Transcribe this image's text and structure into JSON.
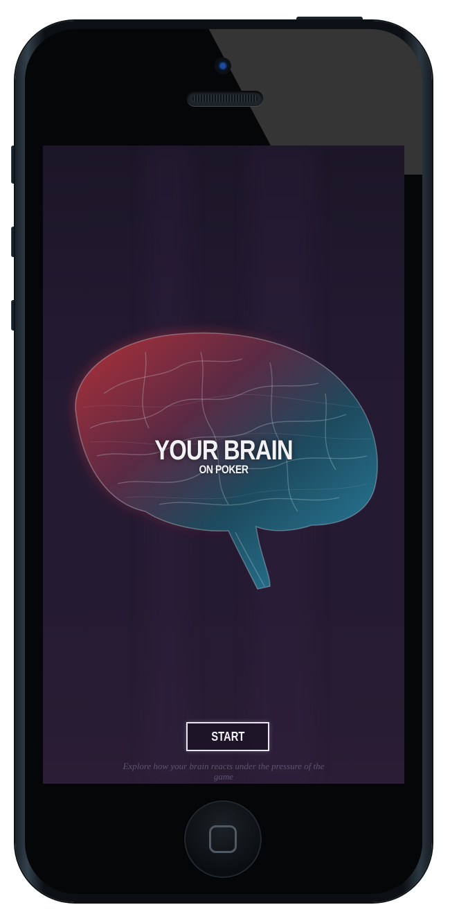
{
  "screen": {
    "title_main": "YOUR BRAIN",
    "title_sub": "ON POKER",
    "start_label": "START",
    "description": "Explore how your brain reacts under the pressure of the game"
  },
  "icons": {
    "camera": "camera-icon",
    "speaker": "speaker-icon",
    "brain": "brain-illustration",
    "home": "home-button-icon"
  },
  "colors": {
    "background": "#241b33",
    "brain_warm": "#d8383c",
    "brain_cool": "#2a7a9a",
    "text": "#f2f2f5"
  }
}
